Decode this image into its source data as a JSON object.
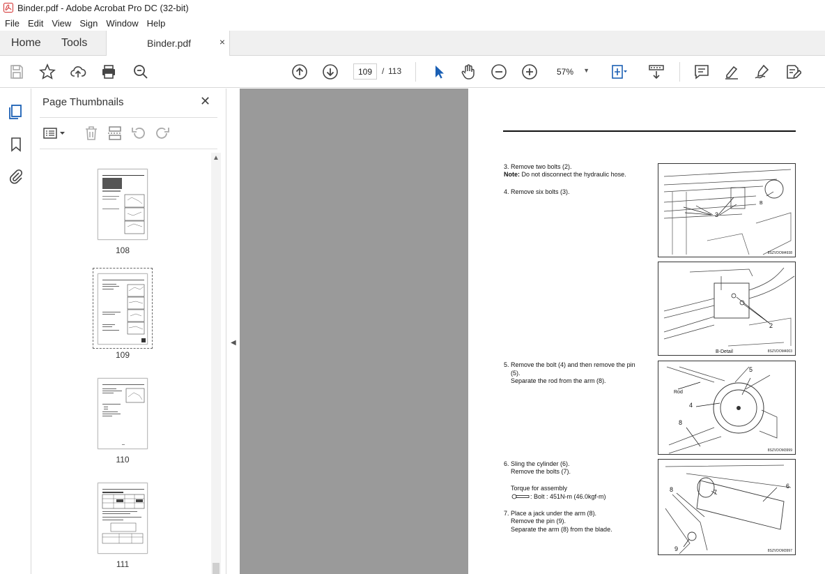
{
  "window": {
    "title": "Binder.pdf - Adobe Acrobat Pro DC (32-bit)"
  },
  "menu": [
    "File",
    "Edit",
    "View",
    "Sign",
    "Window",
    "Help"
  ],
  "tabs": {
    "home": "Home",
    "tools": "Tools",
    "document": "Binder.pdf",
    "close": "×"
  },
  "toolbar": {
    "current_page": "109",
    "separator": "/",
    "total_pages": "113",
    "zoom": "57%"
  },
  "thumbnails": {
    "title": "Page Thumbnails",
    "pages": [
      {
        "label": "108"
      },
      {
        "label": "109",
        "selected": true
      },
      {
        "label": "110"
      },
      {
        "label": "111"
      }
    ]
  },
  "document": {
    "step3_line1": "3. Remove two bolts (2).",
    "note_label": "Note:",
    "note_text": " Do not disconnect the hydraulic hose.",
    "step4": "4. Remove six bolts (3).",
    "step5_line1": "5. Remove the bolt (4) and then remove the pin",
    "step5_line2": "(5).",
    "step5_line3": "Separate the rod from the arm (8).",
    "step6_line1": "6. Sling the cylinder (6).",
    "step6_line2": "Remove the bolts (7).",
    "torque_title": "Torque for assembly",
    "torque_value": ": Bolt : 451N-m (46.0kgf-m)",
    "step7_line1": "7. Place a jack under the arm (8).",
    "step7_line2": "Remove the pin (9).",
    "step7_line3": "Separate the arm (8) from the blade.",
    "figures": [
      {
        "labels": [
          "3",
          "B"
        ],
        "caption": "8SZVDOM4938"
      },
      {
        "labels": [
          "2"
        ],
        "detail": "B-Detail",
        "caption": "8SZVDOM4003"
      },
      {
        "labels": [
          "5",
          "Rod",
          "4",
          "8"
        ],
        "caption": "8SZVDOM3999"
      },
      {
        "labels": [
          "8",
          "7",
          "6",
          "9"
        ],
        "caption": "8SZVDOM3997"
      }
    ]
  }
}
